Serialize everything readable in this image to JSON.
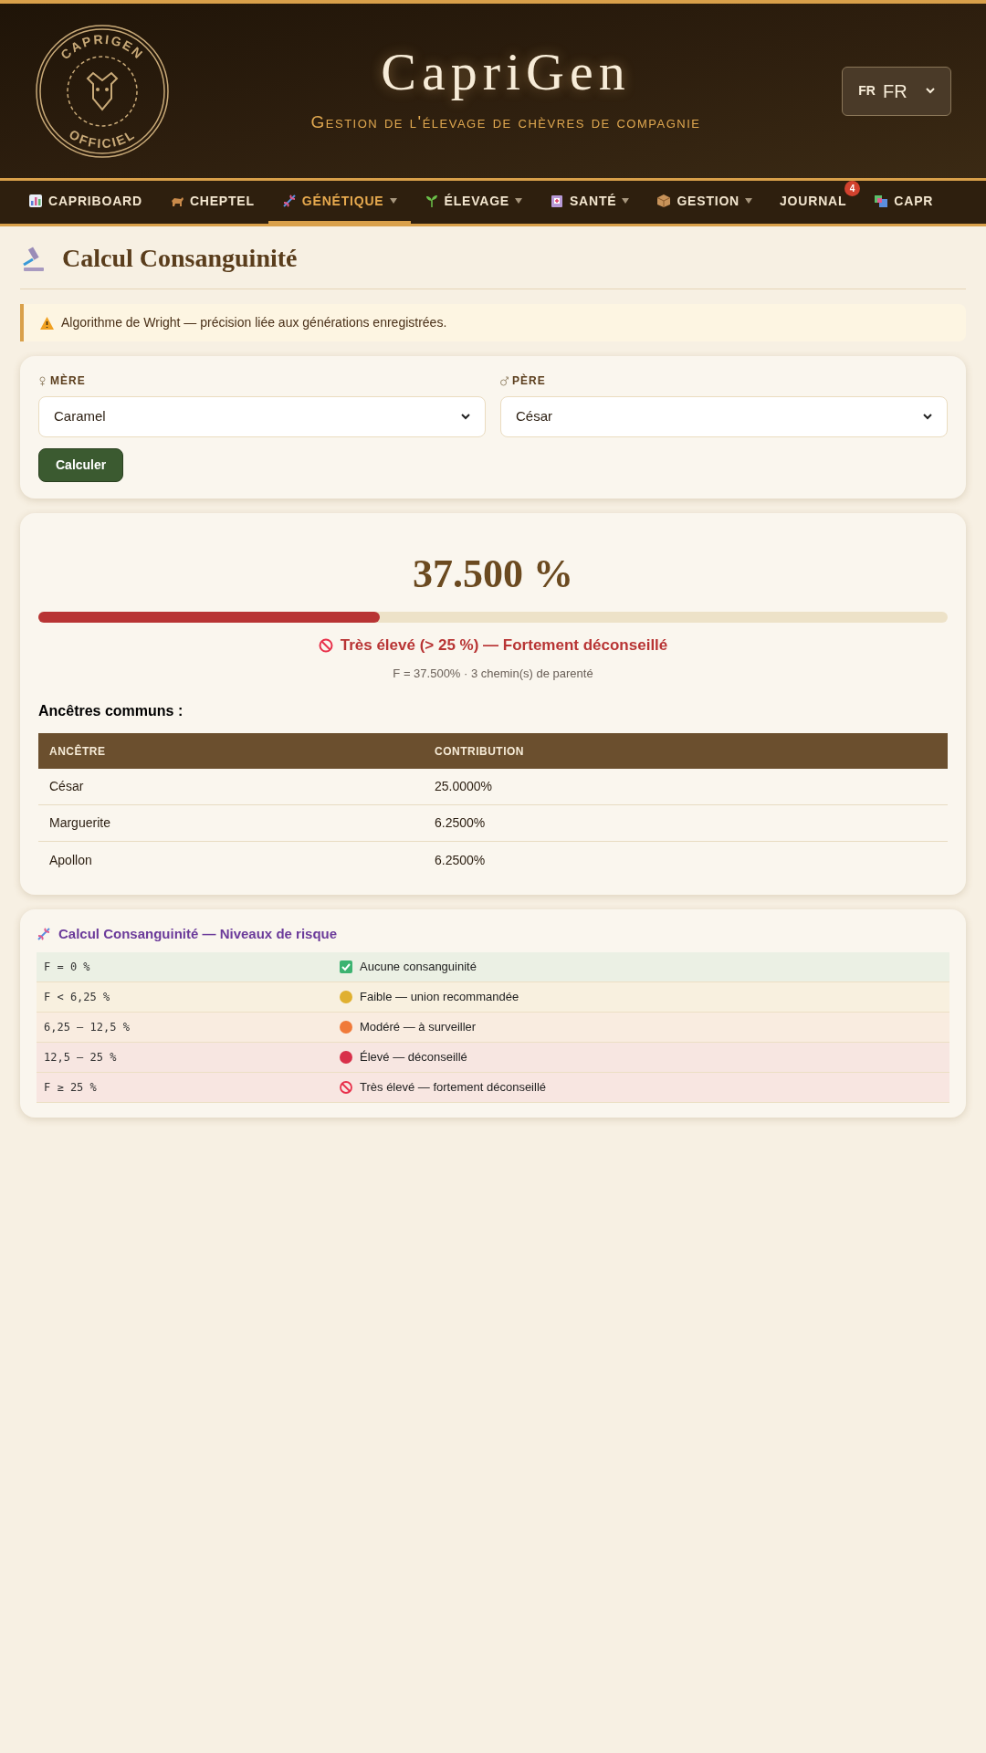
{
  "header": {
    "logo": {
      "top_text": "CAPRIGEN",
      "bottom_text": "OFFICIEL"
    },
    "title": "CapriGen",
    "subtitle": "Gestion de l'élevage de chèvres de compagnie",
    "language": {
      "flag": "FR",
      "label": "FR"
    }
  },
  "nav": [
    {
      "label": "CAPRIBOARD",
      "selected": false,
      "dropdown": false
    },
    {
      "label": "CHEPTEL",
      "selected": false,
      "dropdown": false
    },
    {
      "label": "GÉNÉTIQUE",
      "selected": true,
      "dropdown": true
    },
    {
      "label": "ÉLEVAGE",
      "selected": false,
      "dropdown": true
    },
    {
      "label": "SANTÉ",
      "selected": false,
      "dropdown": true
    },
    {
      "label": "GESTION",
      "selected": false,
      "dropdown": true
    },
    {
      "label": "JOURNAL",
      "selected": false,
      "dropdown": false,
      "badge": "4"
    },
    {
      "label": "CAPR",
      "selected": false,
      "dropdown": false
    }
  ],
  "page_title": "Calcul Consanguinité",
  "alert": "Algorithme de Wright — précision liée aux générations enregistrées.",
  "form": {
    "fields": [
      {
        "label": "MÈRE",
        "value": "Caramel"
      },
      {
        "label": "PÈRE",
        "value": "César"
      }
    ],
    "button": "Calculer"
  },
  "result": {
    "value": "37.500 %",
    "level": 0.375,
    "color": "#b83434",
    "verdict": "Très élevé (> 25 %) — Fortement déconseillé",
    "detail": "F = 37.500% · 3 chemin(s) de parenté",
    "ancestors_title": "Ancêtres communs :",
    "columns": [
      "ANCÊTRE",
      "CONTRIBUTION"
    ],
    "rows": [
      [
        "César",
        "25.0000%"
      ],
      [
        "Marguerite",
        "6.2500%"
      ],
      [
        "Apollon",
        "6.2500%"
      ]
    ]
  },
  "risk": {
    "title": "Calcul Consanguinité — Niveaux de risque",
    "rows": [
      {
        "range": "F = 0 %",
        "label": "Aucune consanguinité",
        "kind": "check",
        "color": "#3cb371"
      },
      {
        "range": "F < 6,25 %",
        "label": "Faible — union recommandée",
        "kind": "dot",
        "color": "#e0b030"
      },
      {
        "range": "6,25 – 12,5 %",
        "label": "Modéré — à surveiller",
        "kind": "dot",
        "color": "#f07a3a"
      },
      {
        "range": "12,5 – 25 %",
        "label": "Élevé — déconseillé",
        "kind": "dot",
        "color": "#d8304a"
      },
      {
        "range": "F ≥ 25 %",
        "label": "Très élevé — fortement déconseillé",
        "kind": "forbidden",
        "color": "#e8304a"
      }
    ]
  }
}
